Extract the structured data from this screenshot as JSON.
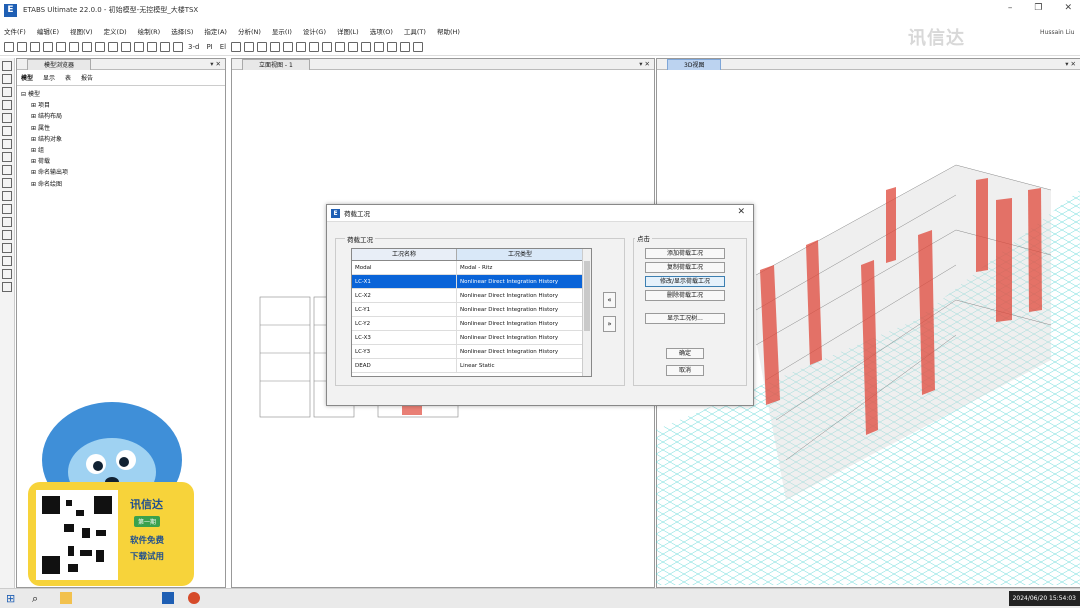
{
  "app": {
    "title": "ETABS Ultimate 22.0.0 - 初始模型-无控模型_大楼TSX",
    "user": "Hussain Liu",
    "watermark": "讯信达"
  },
  "menu": [
    "文件(F)",
    "编辑(E)",
    "视图(V)",
    "定义(D)",
    "绘制(R)",
    "选择(S)",
    "指定(A)",
    "分析(N)",
    "显示(I)",
    "设计(G)",
    "详图(L)",
    "选项(O)",
    "工具(T)",
    "帮助(H)"
  ],
  "toolbar": {
    "view_3d": "3-d",
    "plan": "PI",
    "elev": "El"
  },
  "model_browser": {
    "title": "模型浏览器",
    "tabs": [
      "模型",
      "显示",
      "表",
      "报告"
    ],
    "root": "模型",
    "items": [
      "项目",
      "结构布局",
      "属性",
      "结构对象",
      "组",
      "荷载",
      "命名输出项",
      "命名绘图"
    ]
  },
  "elevation_view": {
    "title": "立面视图 - 1"
  },
  "view3d": {
    "title": "3D视图"
  },
  "dialog": {
    "title": "荷载工况",
    "group_label": "荷载工况",
    "click_label": "点击",
    "col_name": "工况名称",
    "col_type": "工况类型",
    "rows": [
      {
        "name": "Modal",
        "type": "Modal - Ritz",
        "selected": false
      },
      {
        "name": "LC-X1",
        "type": "Nonlinear Direct Integration History",
        "selected": true
      },
      {
        "name": "LC-X2",
        "type": "Nonlinear Direct Integration History",
        "selected": false
      },
      {
        "name": "LC-Y1",
        "type": "Nonlinear Direct Integration History",
        "selected": false
      },
      {
        "name": "LC-Y2",
        "type": "Nonlinear Direct Integration History",
        "selected": false
      },
      {
        "name": "LC-X3",
        "type": "Nonlinear Direct Integration History",
        "selected": false
      },
      {
        "name": "LC-Y3",
        "type": "Nonlinear Direct Integration History",
        "selected": false
      },
      {
        "name": "DEAD",
        "type": "Linear Static",
        "selected": false
      }
    ],
    "btn_add": "添加荷载工况",
    "btn_copy": "复制荷载工况",
    "btn_modify": "修改/显示荷载工况",
    "btn_delete": "删除荷载工况",
    "btn_tree": "显示工况树...",
    "btn_ok": "确定",
    "btn_cancel": "取消",
    "arrow_up": "«",
    "arrow_down": "»"
  },
  "promo": {
    "brand": "讯信达",
    "tag": "第一期",
    "line1": "软件免费",
    "line2": "下载试用"
  },
  "taskbar": {
    "clock": "2024/06/20 15:54:03"
  },
  "colors": {
    "selection": "#0a64d8",
    "shear_wall": "#e0483a",
    "floor_grid": "#3fd0cf",
    "accent": "#1f5fb4"
  }
}
